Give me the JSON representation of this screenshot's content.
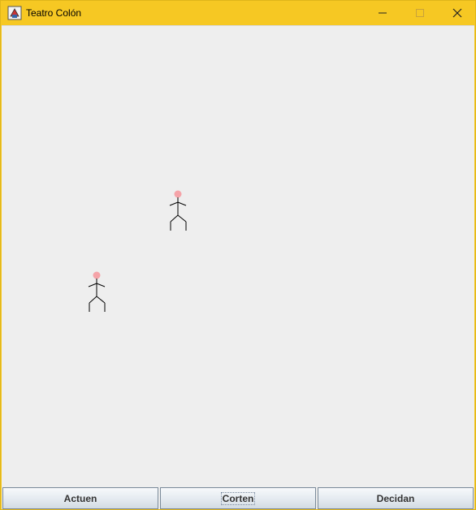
{
  "window": {
    "title": "Teatro Colón",
    "icon": "java-cup-icon"
  },
  "title_controls": {
    "minimize_icon": "minimize-icon",
    "maximize_icon": "maximize-icon",
    "close_icon": "close-icon"
  },
  "stage": {
    "figures": [
      {
        "name": "actor-1",
        "head_color": "#f5a3a8"
      },
      {
        "name": "actor-2",
        "head_color": "#f5a3a8"
      }
    ]
  },
  "buttons": {
    "actuen": "Actuen",
    "corten": "Corten",
    "decidan": "Decidan"
  },
  "colors": {
    "titlebar": "#f6c823",
    "background": "#eeeeee"
  }
}
